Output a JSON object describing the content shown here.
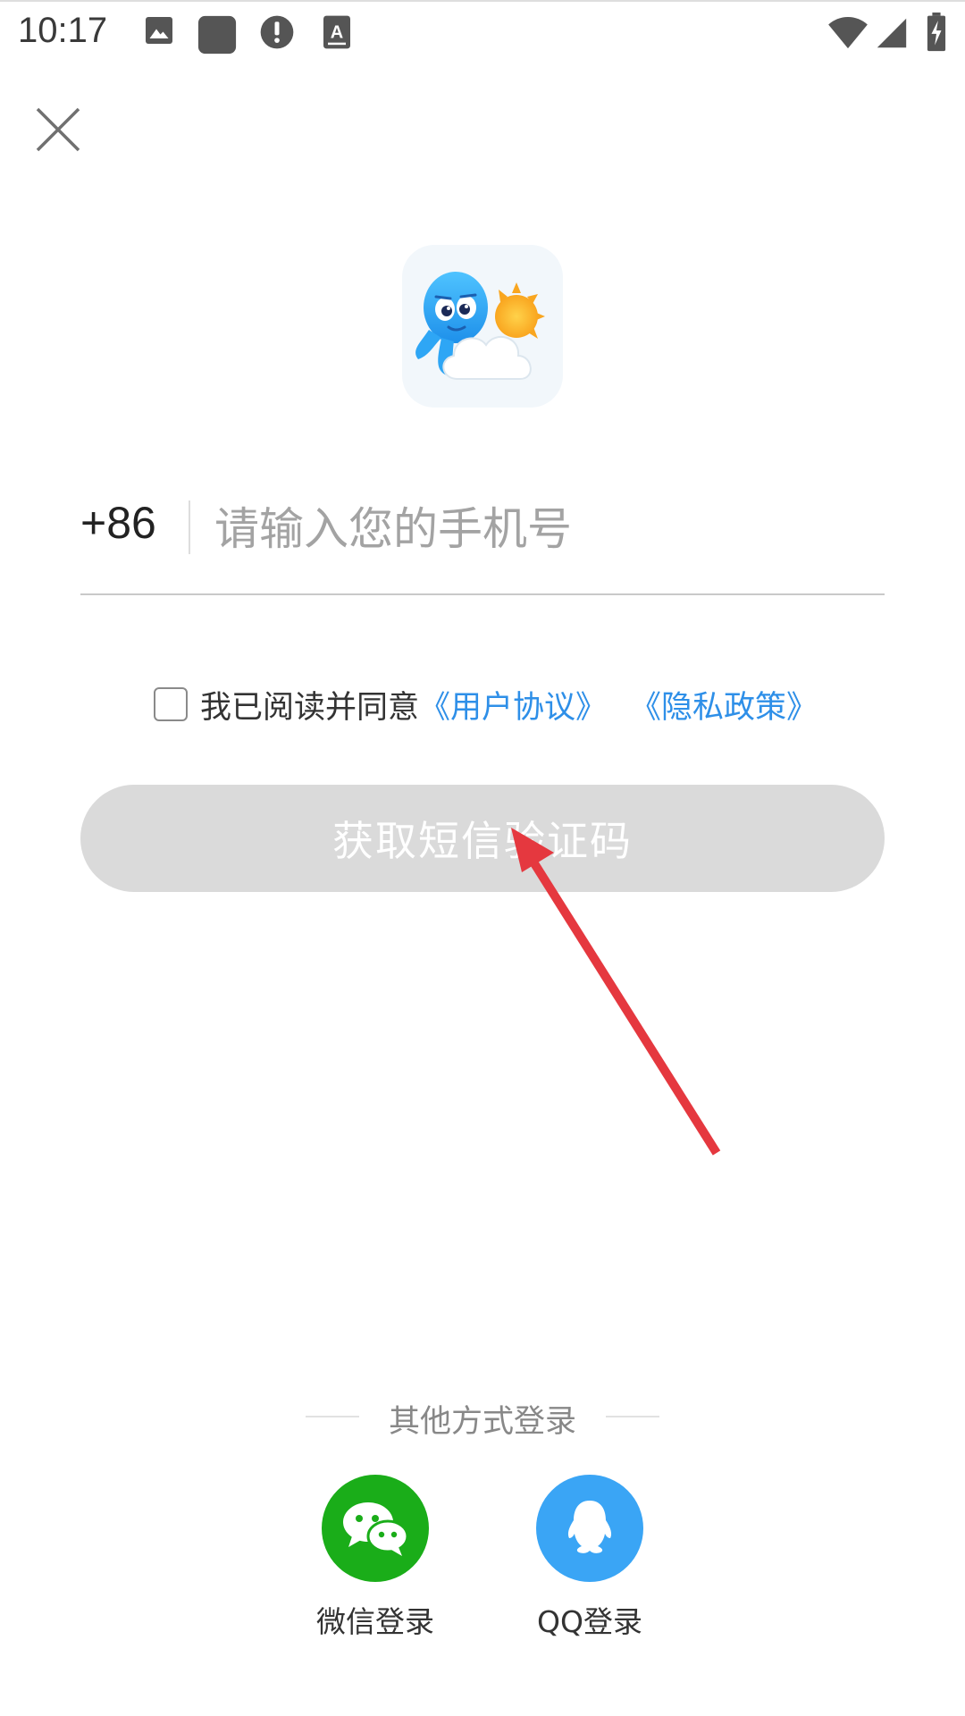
{
  "status_bar": {
    "time": "10:17",
    "icons": [
      "image-icon",
      "square-app-icon",
      "alert-icon",
      "keyboard-a-icon",
      "wifi-icon",
      "signal-icon",
      "battery-charging-icon"
    ]
  },
  "close": {
    "icon": "close-icon"
  },
  "logo": {
    "icon": "octopus-weather-logo"
  },
  "phone": {
    "country_code": "+86",
    "placeholder": "请输入您的手机号",
    "value": ""
  },
  "agreement": {
    "checked": false,
    "text": "我已阅读并同意",
    "user_agreement": "《用户协议》",
    "privacy_policy": "《隐私政策》"
  },
  "sms_button": {
    "label": "获取短信验证码"
  },
  "other_login": {
    "title": "其他方式登录",
    "options": [
      {
        "label": "微信登录",
        "icon": "wechat-icon",
        "color": "#1aad19"
      },
      {
        "label": "QQ登录",
        "icon": "qq-icon",
        "color": "#3aa5f5"
      }
    ]
  },
  "colors": {
    "link": "#2e8fe8",
    "button_disabled": "#dadada",
    "annotation_arrow": "#e5383f"
  }
}
